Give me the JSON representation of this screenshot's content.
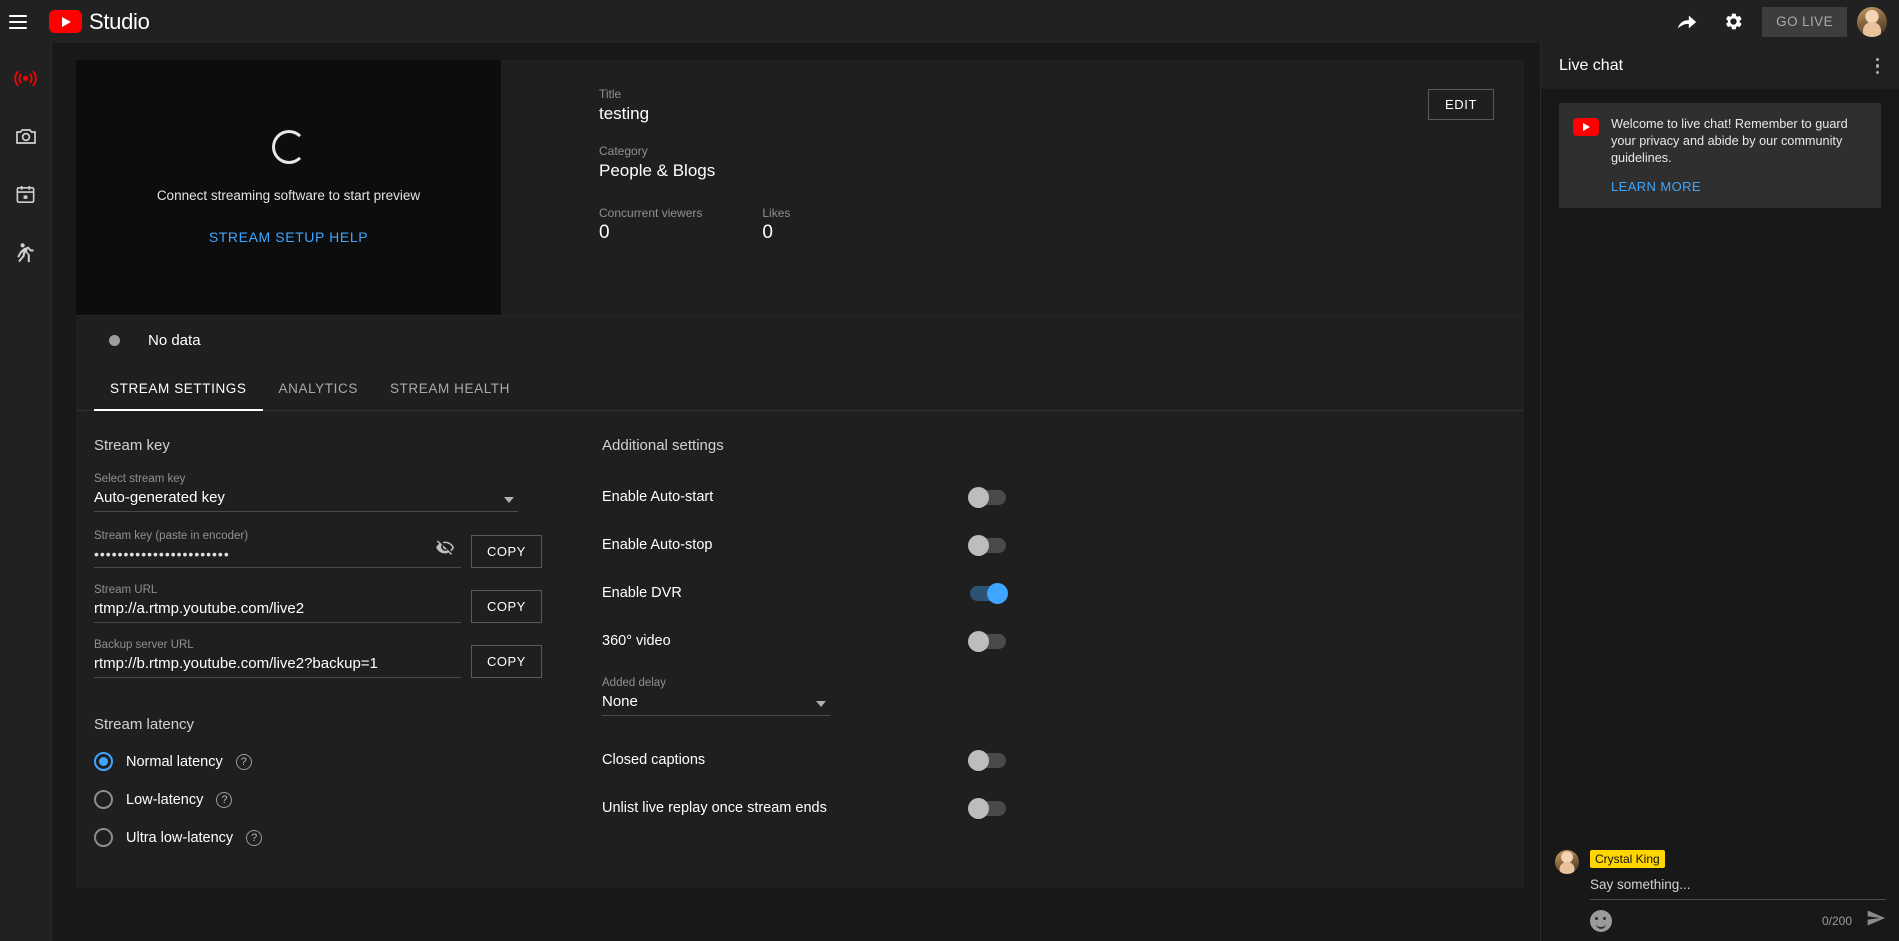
{
  "topbar": {
    "brand": "Studio",
    "menu_icon": "hamburger-icon",
    "share_icon": "share-arrow-icon",
    "settings_icon": "gear-icon",
    "go_live_label": "GO LIVE",
    "avatar": "account-avatar"
  },
  "rail": {
    "items": [
      {
        "name": "stream",
        "icon": "broadcast-icon",
        "active": true
      },
      {
        "name": "webcam",
        "icon": "camera-icon",
        "active": false
      },
      {
        "name": "manage",
        "icon": "calendar-icon",
        "active": false
      },
      {
        "name": "archive",
        "icon": "person-export-icon",
        "active": false
      }
    ]
  },
  "preview": {
    "message": "Connect streaming software to start preview",
    "help_link": "STREAM SETUP HELP"
  },
  "info": {
    "title_label": "Title",
    "title_value": "testing",
    "category_label": "Category",
    "category_value": "People & Blogs",
    "viewers_label": "Concurrent viewers",
    "viewers_value": "0",
    "likes_label": "Likes",
    "likes_value": "0",
    "edit_label": "EDIT"
  },
  "status": {
    "text": "No data"
  },
  "tabs": [
    {
      "label": "STREAM SETTINGS",
      "active": true
    },
    {
      "label": "ANALYTICS",
      "active": false
    },
    {
      "label": "STREAM HEALTH",
      "active": false
    }
  ],
  "stream_key": {
    "section_title": "Stream key",
    "select_label": "Select stream key",
    "select_value": "Auto-generated key",
    "key_label": "Stream key (paste in encoder)",
    "key_value": "•••••••••••••••••••••••",
    "key_copy": "COPY",
    "url_label": "Stream URL",
    "url_value": "rtmp://a.rtmp.youtube.com/live2",
    "url_copy": "COPY",
    "backup_label": "Backup server URL",
    "backup_value": "rtmp://b.rtmp.youtube.com/live2?backup=1",
    "backup_copy": "COPY"
  },
  "latency": {
    "section_title": "Stream latency",
    "options": [
      {
        "label": "Normal latency",
        "selected": true
      },
      {
        "label": "Low-latency",
        "selected": false
      },
      {
        "label": "Ultra low-latency",
        "selected": false
      }
    ]
  },
  "additional": {
    "section_title": "Additional settings",
    "toggles": [
      {
        "label": "Enable Auto-start",
        "on": false
      },
      {
        "label": "Enable Auto-stop",
        "on": false
      },
      {
        "label": "Enable DVR",
        "on": true
      },
      {
        "label": "360° video",
        "on": false
      }
    ],
    "delay_label": "Added delay",
    "delay_value": "None",
    "toggles_after": [
      {
        "label": "Closed captions",
        "on": false
      },
      {
        "label": "Unlist live replay once stream ends",
        "on": false
      }
    ]
  },
  "chat": {
    "title": "Live chat",
    "notice_text": "Welcome to live chat! Remember to guard your privacy and abide by our community guidelines.",
    "notice_link": "LEARN MORE",
    "user_name": "Crystal King",
    "input_placeholder": "Say something...",
    "char_count": "0/200"
  },
  "colors": {
    "accent_blue": "#3ea6ff",
    "brand_red": "#ff0000",
    "chip_yellow": "#ffd600"
  }
}
